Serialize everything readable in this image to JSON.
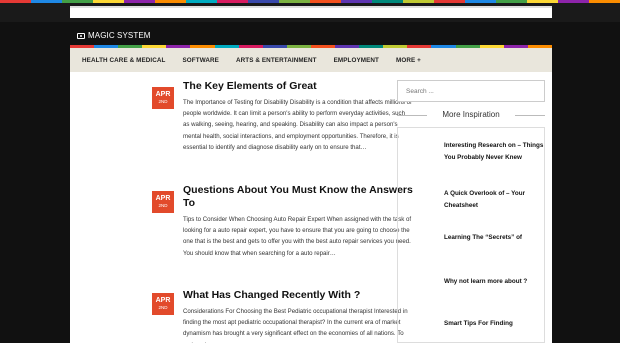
{
  "colors": {
    "stripes": [
      "#e53935",
      "#1e88e5",
      "#43a047",
      "#fdd835",
      "#8e24aa",
      "#fb8c00",
      "#00acc1",
      "#d81b60",
      "#3949ab",
      "#7cb342",
      "#f4511e",
      "#5e35b1",
      "#00897b",
      "#c0ca33",
      "#e53935",
      "#1e88e5",
      "#43a047",
      "#fdd835",
      "#8e24aa",
      "#fb8c00"
    ],
    "accent": "#e24a2b"
  },
  "site": {
    "title": "MAGIC SYSTEM",
    "logo_icon": "camera-icon"
  },
  "nav": {
    "items": [
      "HEALTH CARE & MEDICAL",
      "SOFTWARE",
      "ARTS & ENTERTAINMENT",
      "EMPLOYMENT",
      "MORE +"
    ]
  },
  "posts": [
    {
      "month": "APR",
      "day": "2ND",
      "title": "The Key Elements of Great",
      "excerpt": "The Importance of Testing for Disability Disability is a condition that affects millions of people worldwide. It can limit a person's ability to perform everyday activities, such as walking, seeing, hearing, and speaking. Disability can also impact a person's mental health, social interactions, and employment opportunities. Therefore, it is essential to identify and diagnose disability early on to ensure that…"
    },
    {
      "month": "APR",
      "day": "2ND",
      "title": "Questions About You Must Know the Answers To",
      "excerpt": "Tips to Consider When Choosing Auto Repair Expert When assigned with the task of looking for a auto repair expert, you have to ensure that you are going to choose the one that is the best and gets to offer you with the best auto repair services you need. You should know that when searching for a auto repair…"
    },
    {
      "month": "APR",
      "day": "2ND",
      "title": "What Has Changed Recently With ?",
      "excerpt": "Considerations For Choosing the Best Pediatric occupational therapist Interested in finding the most apt pediatric occupational therapist? In the current era of market dynamism has brought a very significant effect on the economies of all nations. To make a long…"
    }
  ],
  "sidebar": {
    "search_placeholder": "Search ...",
    "heading": "More Inspiration",
    "items": [
      "Interesting Research on – Things You Probably Never Knew",
      "A Quick Overlook of – Your Cheatsheet",
      "Learning The “Secrets” of",
      "Why not learn more about ?",
      "Smart Tips For Finding"
    ]
  }
}
